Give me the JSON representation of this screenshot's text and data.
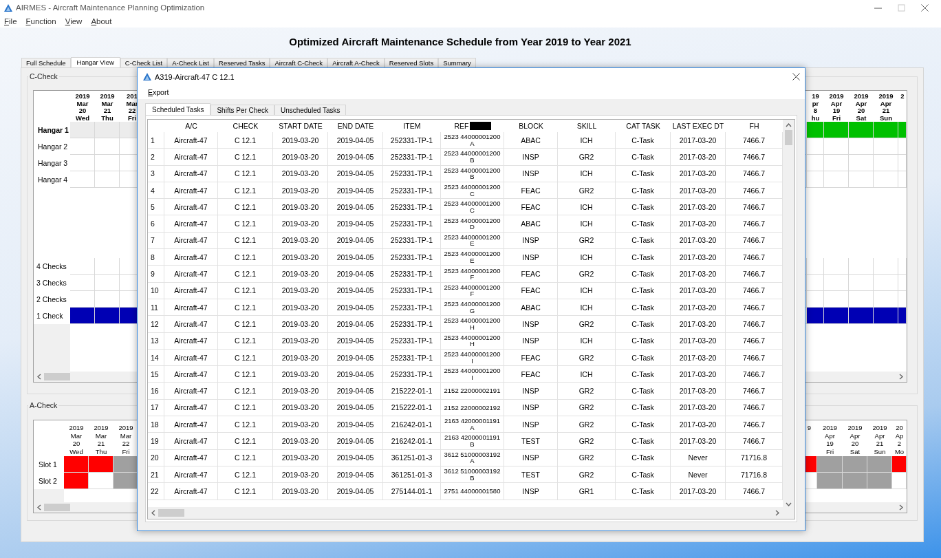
{
  "window": {
    "title": "AIRMES - Aircraft Maintenance Planning Optimization"
  },
  "menu": [
    "File",
    "Function",
    "View",
    "About"
  ],
  "heading": "Optimized Aircraft Maintenance Schedule from Year 2019 to Year 2021",
  "tabs": [
    {
      "label": "Full Schedule",
      "selected": false
    },
    {
      "label": "Hangar View",
      "selected": true
    },
    {
      "label": "C-Check List",
      "selected": false
    },
    {
      "label": "A-Check List",
      "selected": false
    },
    {
      "label": "Reserved Tasks",
      "selected": false
    },
    {
      "label": "Aircraft C-Check",
      "selected": false
    },
    {
      "label": "Aircraft A-Check",
      "selected": false
    },
    {
      "label": "Reserved Slots",
      "selected": false
    },
    {
      "label": "Summary",
      "selected": false
    }
  ],
  "c_check": {
    "title": "C-Check",
    "left_columns": [
      "2019\nMar\n20\nWed",
      "2019\nMar\n21\nThu",
      "201\nMar\n22\nFri"
    ],
    "right_columns": [
      "19\npr\n8\nhu",
      "2019\nApr\n19\nFri",
      "2019\nApr\n20\nSat",
      "2019\nApr\n21\nSun",
      "2"
    ],
    "rows": [
      {
        "label": "Hangar 1",
        "kind": "hangar",
        "selected": true,
        "left": [
          {
            "color": "#ececec"
          },
          {
            "color": "#ececec"
          },
          {
            "color": "#ececec"
          }
        ],
        "right": [
          {
            "color": "#00c000"
          },
          {
            "color": "#00c000"
          },
          {
            "color": "#00c000"
          },
          {
            "color": "#00c000"
          },
          {
            "color": "#00c000"
          }
        ]
      },
      {
        "label": "Hangar 2",
        "kind": "hangar",
        "selected": false,
        "left": [
          {
            "color": "#ffffff"
          },
          {
            "color": "#ffffff"
          },
          {
            "color": "#ffffff"
          }
        ],
        "right": [
          {
            "color": "#ffffff"
          },
          {
            "color": "#ffffff"
          },
          {
            "color": "#ffffff"
          },
          {
            "color": "#ffffff"
          },
          {
            "color": "#ffffff"
          }
        ]
      },
      {
        "label": "Hangar 3",
        "kind": "hangar",
        "selected": false,
        "left": [
          {
            "color": "#ffffff"
          },
          {
            "color": "#ffffff"
          },
          {
            "color": "#ffffff"
          }
        ],
        "right": [
          {
            "color": "#ffffff"
          },
          {
            "color": "#ffffff"
          },
          {
            "color": "#ffffff"
          },
          {
            "color": "#ffffff"
          },
          {
            "color": "#ffffff"
          }
        ]
      },
      {
        "label": "Hangar 4",
        "kind": "hangar",
        "selected": false,
        "left": [
          {
            "color": "#ffffff"
          },
          {
            "color": "#ffffff"
          },
          {
            "color": "#ffffff"
          }
        ],
        "right": [
          {
            "color": "#ffffff"
          },
          {
            "color": "#ffffff"
          },
          {
            "color": "#ffffff"
          },
          {
            "color": "#ffffff"
          },
          {
            "color": "#ffffff"
          }
        ]
      },
      {
        "label": "4 Checks",
        "kind": "count",
        "selected": false,
        "left": [
          {
            "color": "#ffffff"
          },
          {
            "color": "#ffffff"
          },
          {
            "color": "#ffffff"
          }
        ],
        "right": [
          {
            "color": "#ffffff"
          },
          {
            "color": "#ffffff"
          },
          {
            "color": "#ffffff"
          },
          {
            "color": "#ffffff"
          },
          {
            "color": "#ffffff"
          }
        ]
      },
      {
        "label": "3 Checks",
        "kind": "count",
        "selected": false,
        "left": [
          {
            "color": "#ffffff"
          },
          {
            "color": "#ffffff"
          },
          {
            "color": "#ffffff"
          }
        ],
        "right": [
          {
            "color": "#ffffff"
          },
          {
            "color": "#ffffff"
          },
          {
            "color": "#ffffff"
          },
          {
            "color": "#ffffff"
          },
          {
            "color": "#ffffff"
          }
        ]
      },
      {
        "label": "2 Checks",
        "kind": "count",
        "selected": false,
        "left": [
          {
            "color": "#ffffff"
          },
          {
            "color": "#ffffff"
          },
          {
            "color": "#ffffff"
          }
        ],
        "right": [
          {
            "color": "#ffffff"
          },
          {
            "color": "#ffffff"
          },
          {
            "color": "#ffffff"
          },
          {
            "color": "#ffffff"
          },
          {
            "color": "#ffffff"
          }
        ]
      },
      {
        "label": "1 Check",
        "kind": "count",
        "selected": false,
        "left": [
          {
            "color": "#0000b4"
          },
          {
            "color": "#0000b4"
          },
          {
            "color": "#0000b4"
          }
        ],
        "right": [
          {
            "color": "#0000b4"
          },
          {
            "color": "#0000b4"
          },
          {
            "color": "#0000b4"
          },
          {
            "color": "#0000b4"
          },
          {
            "color": "#0000b4"
          }
        ]
      }
    ]
  },
  "a_check": {
    "title": "A-Check",
    "left_columns": [
      "2019\nMar\n20\nWed",
      "2019\nMar\n21\nThu",
      "2019\nMar\n22\nFri"
    ],
    "right_columns": [
      "9",
      "2019\nApr\n19\nFri",
      "2019\nApr\n20\nSat",
      "2019\nApr\n21\nSun",
      "20\nAp\n2\nMo"
    ],
    "rows": [
      {
        "label": "Slot 1",
        "left": [
          {
            "color": "#ff0000"
          },
          {
            "color": "#ff0000"
          },
          {
            "color": "#a0a0a0"
          }
        ],
        "right": [
          {
            "color": "#ff0000"
          },
          {
            "color": "#a0a0a0"
          },
          {
            "color": "#a0a0a0"
          },
          {
            "color": "#a0a0a0"
          },
          {
            "color": "#ff0000"
          }
        ]
      },
      {
        "label": "Slot 2",
        "left": [
          {
            "color": "#ff0000"
          },
          {
            "color": "#ffffff"
          },
          {
            "color": "#a0a0a0"
          }
        ],
        "right": [
          {
            "color": "#ffffff"
          },
          {
            "color": "#a0a0a0"
          },
          {
            "color": "#a0a0a0"
          },
          {
            "color": "#a0a0a0"
          },
          {
            "color": "#ffffff"
          }
        ]
      }
    ]
  },
  "dialog": {
    "title": "A319-Aircraft-47 C 12.1",
    "menu": [
      "Export"
    ],
    "tabs": [
      {
        "label": "Scheduled Tasks",
        "selected": true
      },
      {
        "label": "Shifts Per Check",
        "selected": false
      },
      {
        "label": "Unscheduled Tasks",
        "selected": false
      }
    ],
    "columns": [
      {
        "label": "A/C",
        "redacted": false
      },
      {
        "label": "CHECK",
        "redacted": false
      },
      {
        "label": "START DATE",
        "redacted": false
      },
      {
        "label": "END DATE",
        "redacted": false
      },
      {
        "label": "ITEM",
        "redacted": false
      },
      {
        "label": "REF",
        "redacted": true
      },
      {
        "label": "BLOCK",
        "redacted": false
      },
      {
        "label": "SKILL",
        "redacted": false
      },
      {
        "label": "CAT TASK",
        "redacted": false
      },
      {
        "label": "LAST EXEC DT",
        "redacted": false
      },
      {
        "label": "FH",
        "redacted": false
      }
    ],
    "rows": [
      {
        "number": "1",
        "cells": [
          "Aircraft-47",
          "C 12.1",
          "2019-03-20",
          "2019-04-05",
          "252331-TP-1",
          "2523 44000001200\nA",
          "ABAC",
          "ICH",
          "C-Task",
          "2017-03-20",
          "7466.7"
        ]
      },
      {
        "number": "2",
        "cells": [
          "Aircraft-47",
          "C 12.1",
          "2019-03-20",
          "2019-04-05",
          "252331-TP-1",
          "2523 44000001200\nB",
          "INSP",
          "GR2",
          "C-Task",
          "2017-03-20",
          "7466.7"
        ]
      },
      {
        "number": "3",
        "cells": [
          "Aircraft-47",
          "C 12.1",
          "2019-03-20",
          "2019-04-05",
          "252331-TP-1",
          "2523 44000001200\nB",
          "INSP",
          "ICH",
          "C-Task",
          "2017-03-20",
          "7466.7"
        ]
      },
      {
        "number": "4",
        "cells": [
          "Aircraft-47",
          "C 12.1",
          "2019-03-20",
          "2019-04-05",
          "252331-TP-1",
          "2523 44000001200\nC",
          "FEAC",
          "GR2",
          "C-Task",
          "2017-03-20",
          "7466.7"
        ]
      },
      {
        "number": "5",
        "cells": [
          "Aircraft-47",
          "C 12.1",
          "2019-03-20",
          "2019-04-05",
          "252331-TP-1",
          "2523 44000001200\nC",
          "FEAC",
          "ICH",
          "C-Task",
          "2017-03-20",
          "7466.7"
        ]
      },
      {
        "number": "6",
        "cells": [
          "Aircraft-47",
          "C 12.1",
          "2019-03-20",
          "2019-04-05",
          "252331-TP-1",
          "2523 44000001200\nD",
          "ABAC",
          "ICH",
          "C-Task",
          "2017-03-20",
          "7466.7"
        ]
      },
      {
        "number": "7",
        "cells": [
          "Aircraft-47",
          "C 12.1",
          "2019-03-20",
          "2019-04-05",
          "252331-TP-1",
          "2523 44000001200\nE",
          "INSP",
          "GR2",
          "C-Task",
          "2017-03-20",
          "7466.7"
        ]
      },
      {
        "number": "8",
        "cells": [
          "Aircraft-47",
          "C 12.1",
          "2019-03-20",
          "2019-04-05",
          "252331-TP-1",
          "2523 44000001200\nE",
          "INSP",
          "ICH",
          "C-Task",
          "2017-03-20",
          "7466.7"
        ]
      },
      {
        "number": "9",
        "cells": [
          "Aircraft-47",
          "C 12.1",
          "2019-03-20",
          "2019-04-05",
          "252331-TP-1",
          "2523 44000001200\nF",
          "FEAC",
          "GR2",
          "C-Task",
          "2017-03-20",
          "7466.7"
        ]
      },
      {
        "number": "10",
        "cells": [
          "Aircraft-47",
          "C 12.1",
          "2019-03-20",
          "2019-04-05",
          "252331-TP-1",
          "2523 44000001200\nF",
          "FEAC",
          "ICH",
          "C-Task",
          "2017-03-20",
          "7466.7"
        ]
      },
      {
        "number": "11",
        "cells": [
          "Aircraft-47",
          "C 12.1",
          "2019-03-20",
          "2019-04-05",
          "252331-TP-1",
          "2523 44000001200\nG",
          "ABAC",
          "ICH",
          "C-Task",
          "2017-03-20",
          "7466.7"
        ]
      },
      {
        "number": "12",
        "cells": [
          "Aircraft-47",
          "C 12.1",
          "2019-03-20",
          "2019-04-05",
          "252331-TP-1",
          "2523 44000001200\nH",
          "INSP",
          "GR2",
          "C-Task",
          "2017-03-20",
          "7466.7"
        ]
      },
      {
        "number": "13",
        "cells": [
          "Aircraft-47",
          "C 12.1",
          "2019-03-20",
          "2019-04-05",
          "252331-TP-1",
          "2523 44000001200\nH",
          "INSP",
          "ICH",
          "C-Task",
          "2017-03-20",
          "7466.7"
        ]
      },
      {
        "number": "14",
        "cells": [
          "Aircraft-47",
          "C 12.1",
          "2019-03-20",
          "2019-04-05",
          "252331-TP-1",
          "2523 44000001200\nI",
          "FEAC",
          "GR2",
          "C-Task",
          "2017-03-20",
          "7466.7"
        ]
      },
      {
        "number": "15",
        "cells": [
          "Aircraft-47",
          "C 12.1",
          "2019-03-20",
          "2019-04-05",
          "252331-TP-1",
          "2523 44000001200\nI",
          "FEAC",
          "ICH",
          "C-Task",
          "2017-03-20",
          "7466.7"
        ]
      },
      {
        "number": "16",
        "cells": [
          "Aircraft-47",
          "C 12.1",
          "2019-03-20",
          "2019-04-05",
          "215222-01-1",
          "2152 22000002191",
          "INSP",
          "GR2",
          "C-Task",
          "2017-03-20",
          "7466.7"
        ]
      },
      {
        "number": "17",
        "cells": [
          "Aircraft-47",
          "C 12.1",
          "2019-03-20",
          "2019-04-05",
          "215222-01-1",
          "2152 22000002192",
          "INSP",
          "GR2",
          "C-Task",
          "2017-03-20",
          "7466.7"
        ]
      },
      {
        "number": "18",
        "cells": [
          "Aircraft-47",
          "C 12.1",
          "2019-03-20",
          "2019-04-05",
          "216242-01-1",
          "2163 42000001191\nA",
          "INSP",
          "GR2",
          "C-Task",
          "2017-03-20",
          "7466.7"
        ]
      },
      {
        "number": "19",
        "cells": [
          "Aircraft-47",
          "C 12.1",
          "2019-03-20",
          "2019-04-05",
          "216242-01-1",
          "2163 42000001191\nB",
          "TEST",
          "GR2",
          "C-Task",
          "2017-03-20",
          "7466.7"
        ]
      },
      {
        "number": "20",
        "cells": [
          "Aircraft-47",
          "C 12.1",
          "2019-03-20",
          "2019-04-05",
          "361251-01-3",
          "3612 51000003192\nA",
          "INSP",
          "GR2",
          "C-Task",
          "Never",
          "71716.8"
        ]
      },
      {
        "number": "21",
        "cells": [
          "Aircraft-47",
          "C 12.1",
          "2019-03-20",
          "2019-04-05",
          "361251-01-3",
          "3612 51000003192\nB",
          "TEST",
          "GR2",
          "C-Task",
          "Never",
          "71716.8"
        ]
      },
      {
        "number": "22",
        "cells": [
          "Aircraft-47",
          "C 12.1",
          "2019-03-20",
          "2019-04-05",
          "275144-01-1",
          "2751 44000001580",
          "INSP",
          "GR1",
          "C-Task",
          "2017-03-20",
          "7466.7"
        ]
      }
    ]
  }
}
